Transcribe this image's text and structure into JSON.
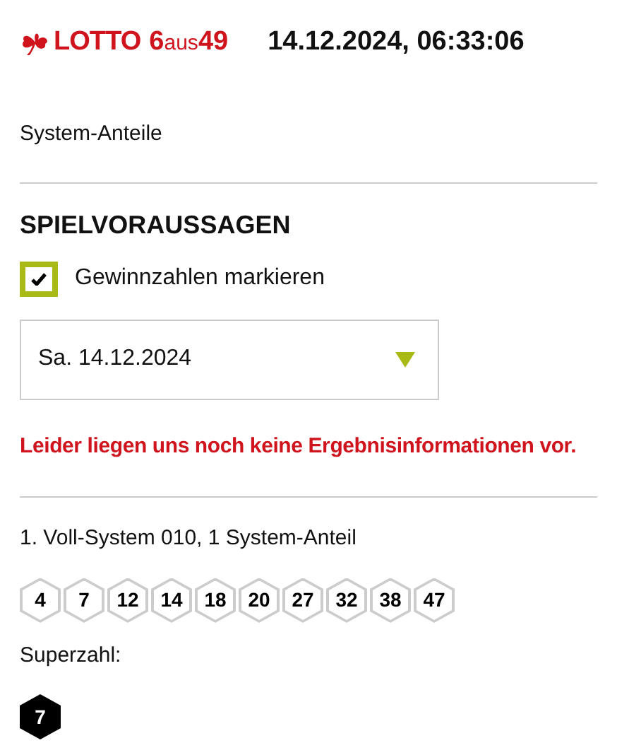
{
  "header": {
    "logo": {
      "brand": "LOTTO",
      "six": "6",
      "aus": "aus",
      "fortynine": "49"
    },
    "timestamp": "14.12.2024, 06:33:06"
  },
  "section_label": "System-Anteile",
  "heading": "SPIELVORAUSSAGEN",
  "checkbox": {
    "label": "Gewinnzahlen markieren",
    "checked": true
  },
  "date_select": {
    "value": "Sa. 14.12.2024"
  },
  "error": "Leider liegen uns noch keine Ergebnisinformationen vor.",
  "ticket": {
    "title": "1. Voll-System 010, 1 System-Anteil",
    "numbers": [
      "4",
      "7",
      "12",
      "14",
      "18",
      "20",
      "27",
      "32",
      "38",
      "47"
    ],
    "superzahl_label": "Superzahl:",
    "superzahl": "7"
  }
}
